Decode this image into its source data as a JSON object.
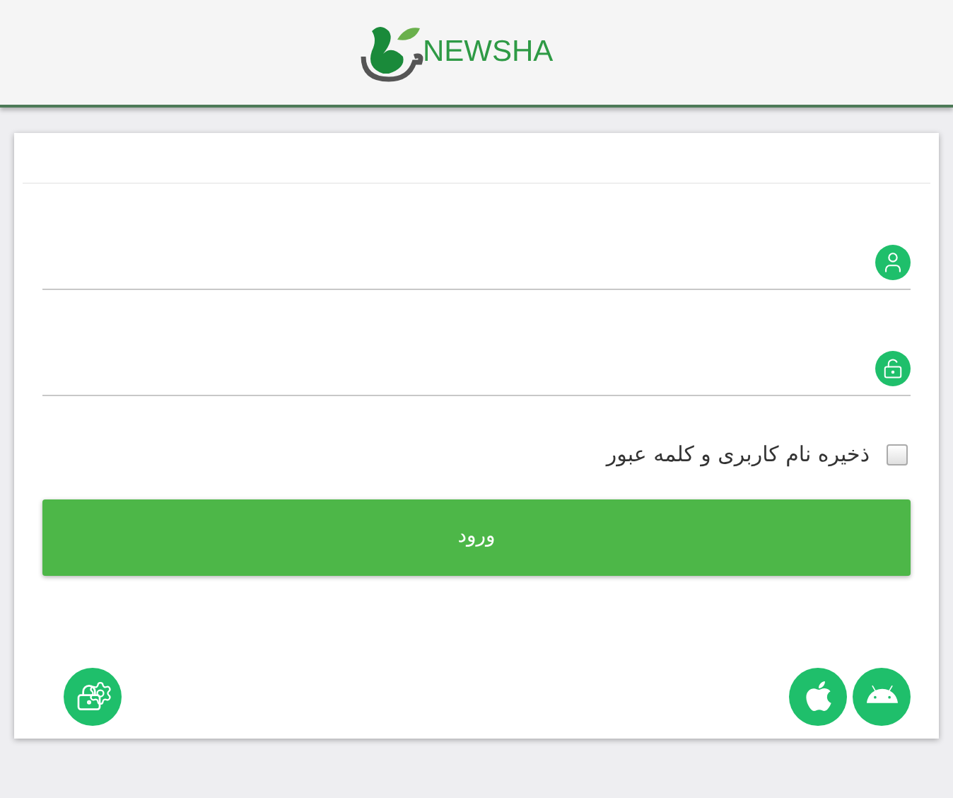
{
  "header": {
    "logo_text": "NEWSHA"
  },
  "form": {
    "fields": [
      {
        "kind": "username"
      },
      {
        "kind": "password"
      }
    ],
    "remember": {
      "label": "ذخیره نام کاربری و کلمه عبور",
      "checked": false
    },
    "submit": {
      "label": "ورود"
    }
  },
  "footer": {
    "left_icons": [
      {
        "kind": "security"
      }
    ],
    "right_icons": [
      {
        "kind": "apple"
      },
      {
        "kind": "android"
      }
    ]
  }
}
